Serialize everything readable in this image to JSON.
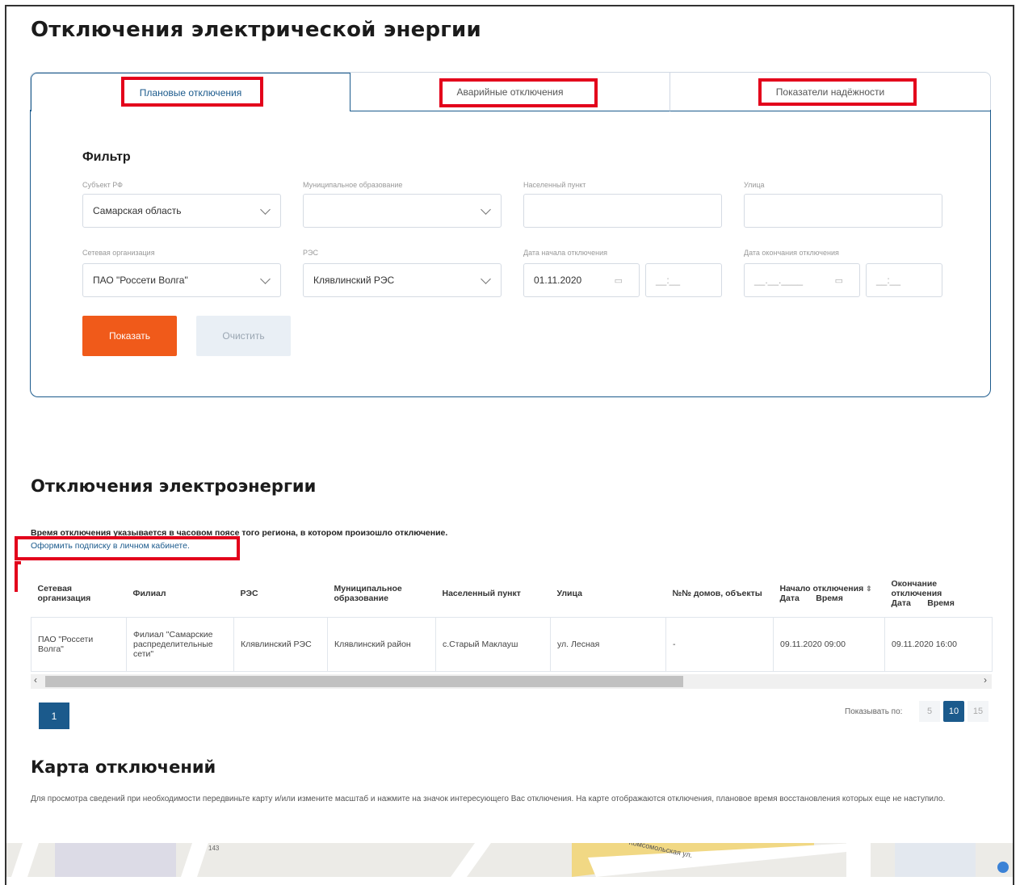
{
  "page": {
    "title": "Отключения электрической энергии"
  },
  "tabs": [
    {
      "label": "Плановые отключения",
      "active": true
    },
    {
      "label": "Аварийные отключения",
      "active": false
    },
    {
      "label": "Показатели надёжности",
      "active": false
    }
  ],
  "filter": {
    "title": "Фильтр",
    "subject_label": "Субъект РФ",
    "subject_value": "Самарская область",
    "municipal_label": "Муниципальное образование",
    "municipal_value": "",
    "settlement_label": "Населенный пункт",
    "street_label": "Улица",
    "org_label": "Сетевая организация",
    "org_value": "ПАО \"Россети Волга\"",
    "res_label": "РЭС",
    "res_value": "Клявлинский РЭС",
    "date_start_label": "Дата начала отключения",
    "date_start_value": "01.11.2020",
    "time_start_placeholder": "__:__",
    "date_end_label": "Дата окончания отключения",
    "date_end_placeholder": "__.__.____",
    "time_end_placeholder": "__:__",
    "show_button": "Показать",
    "clear_button": "Очистить"
  },
  "results": {
    "title": "Отключения электроэнергии",
    "note": "Время отключения указывается в часовом поясе того региона, в котором произошло отключение.",
    "subscribe_link": "Оформить подписку в личном кабинете.",
    "columns": [
      "Сетевая организация",
      "Филиал",
      "РЭС",
      "Муниципальное образование",
      "Населенный пункт",
      "Улица",
      "№№ домов, объекты",
      "Начало отключения",
      "Окончание отключения"
    ],
    "subcol_date": "Дата",
    "subcol_time": "Время",
    "rows": [
      [
        "ПАО \"Россети Волга\"",
        "Филиал \"Самарские распределительные сети\"",
        "Клявлинский РЭС",
        "Клявлинский район",
        "с.Старый Маклауш",
        "ул. Лесная",
        "-",
        "09.11.2020 09:00",
        "09.11.2020 16:00"
      ]
    ]
  },
  "pagination": {
    "current_page": "1",
    "per_page_label": "Показывать по:",
    "per_page_options": [
      "5",
      "10",
      "15"
    ],
    "per_page_selected": "10"
  },
  "map": {
    "title": "Карта отключений",
    "description": "Для просмотра сведений при необходимости передвиньте карту и/или измените масштаб и нажмите на значок интересующего Вас отключения. На карте отображаются отключения, плановое время восстановления которых еще не наступило.",
    "street_label": "Комсомольская ул.",
    "building_number": "143"
  },
  "colors": {
    "accent_blue": "#1b5a8c",
    "orange": "#f05a1a",
    "highlight_red": "#e3001b"
  }
}
